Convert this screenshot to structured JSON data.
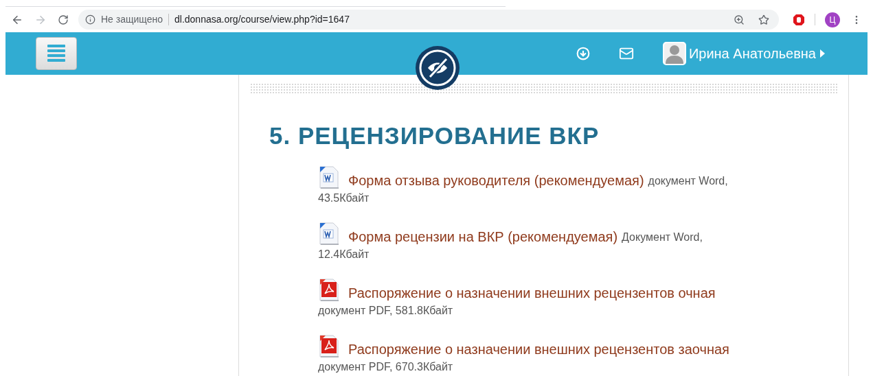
{
  "browser": {
    "security": "Не защищено",
    "url": "dl.donnasa.org/course/view.php?id=1647",
    "profile_initial": "Ц"
  },
  "header": {
    "user_name": "Ирина Анатольевна"
  },
  "section": {
    "title": "5. РЕЦЕНЗИРОВАНИЕ ВКР",
    "resources": [
      {
        "kind": "word",
        "title": "Форма отзыва руководителя (рекомендуемая)",
        "meta_inline": "документ Word,",
        "meta_below": "43.5Кбайт"
      },
      {
        "kind": "word",
        "title": "Форма рецензии на ВКР (рекомендуемая)",
        "meta_inline": "Документ Word,",
        "meta_below": "12.4Кбайт"
      },
      {
        "kind": "pdf",
        "title": "Распоряжение о назначении внешних рецензентов очная",
        "meta_below": "документ PDF, 581.8Кбайт"
      },
      {
        "kind": "pdf",
        "title": "Распоряжение о назначении внешних рецензентов заочная",
        "meta_below": "документ PDF, 670.3Кбайт"
      }
    ]
  }
}
